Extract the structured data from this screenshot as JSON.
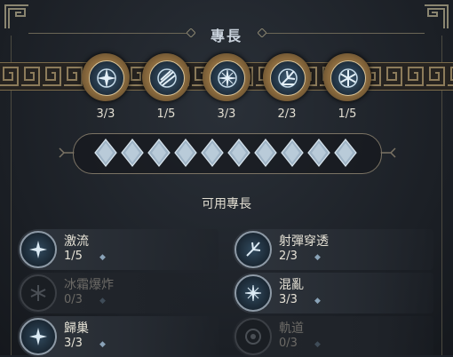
{
  "title": "專長",
  "equipped": [
    {
      "rank": "3/3",
      "icon": "compass-star-icon"
    },
    {
      "rank": "1/5",
      "icon": "arrow-volley-icon"
    },
    {
      "rank": "3/3",
      "icon": "burst-sigil-icon"
    },
    {
      "rank": "2/3",
      "icon": "scatter-arrows-icon"
    },
    {
      "rank": "1/5",
      "icon": "snowflake-icon"
    }
  ],
  "points": {
    "total": 10,
    "icon": "diamond-point-icon"
  },
  "available_heading": "可用專長",
  "perks": [
    {
      "name": "激流",
      "count": "1/5",
      "locked": false,
      "icon": "compass-star-icon"
    },
    {
      "name": "射彈穿透",
      "count": "2/3",
      "locked": false,
      "icon": "scatter-arrows-icon"
    },
    {
      "name": "冰霜爆炸",
      "count": "0/3",
      "locked": true,
      "icon": "frost-burst-icon"
    },
    {
      "name": "混亂",
      "count": "3/3",
      "locked": false,
      "icon": "burst-sigil-icon"
    },
    {
      "name": "歸巢",
      "count": "3/3",
      "locked": false,
      "icon": "compass-star-icon"
    },
    {
      "name": "軌道",
      "count": "0/3",
      "locked": true,
      "icon": "orbit-icon"
    }
  ],
  "colors": {
    "gold": "#b79563",
    "ice": "#c7dcea",
    "panel": "#1d2229"
  }
}
